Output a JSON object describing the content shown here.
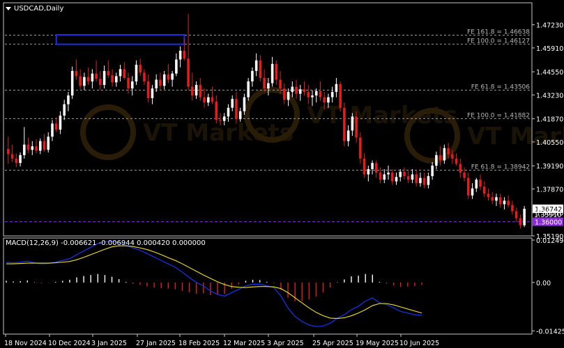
{
  "header": {
    "symbol_label": "USDCAD,Daily",
    "macd_label": "MACD(12,26,9) -0.006621 -0.006944 0.000420 0.000000"
  },
  "watermark": "VT Markets",
  "colors": {
    "background": "#000000",
    "frame": "#c8c8c8",
    "grid_dash": "#9a9a9a",
    "bull_candle": "#ffffff",
    "bear_candle": "#e01e1e",
    "price_line": "#8a2be2",
    "macd_main": "#1530e0",
    "macd_signal": "#f0e020",
    "hist_pos": "#ffffff",
    "hist_neg": "#e01e1e",
    "box": "#1c2fe6"
  },
  "chart_data": [
    {
      "type": "candlestick",
      "title": "USDCAD,Daily",
      "ylim": [
        1.3519,
        1.4785
      ],
      "y_ticks": [
        "1.47230",
        "1.45910",
        "1.44550",
        "1.43230",
        "1.41870",
        "1.40550",
        "1.39190",
        "1.37870",
        "1.36510",
        "1.35190"
      ],
      "x_ticks": [
        "18 Nov 2024",
        "10 Dec 2024",
        "3 Jan 2025",
        "27 Jan 2025",
        "18 Feb 2025",
        "12 Mar 2025",
        "3 Apr 2025",
        "25 Apr 2025",
        "19 May 2025",
        "10 Jun 2025"
      ],
      "fib_levels": [
        {
          "label": "FE 161.8 = 1.46638",
          "value": 1.46638
        },
        {
          "label": "FE 100.0 = 1.46127",
          "value": 1.46127
        },
        {
          "label": "FE 61.8 = 1.43506",
          "value": 1.43506
        },
        {
          "label": "FE 100.0 = 1.41882",
          "value": 1.41882
        },
        {
          "label": "FE 61.8 = 1.38942",
          "value": 1.38942
        }
      ],
      "current_price": "1.36742",
      "marked_level": {
        "label": "1.36000",
        "value": 1.36
      },
      "partial_label": "1.35910",
      "highlight_zone": {
        "x_from": "6 Dec 2024",
        "x_to": "31 Jan 2025",
        "y_from": 1.4612,
        "y_to": 1.4666
      },
      "candles": [
        [
          1.4015,
          1.4085,
          1.393,
          1.3985
        ],
        [
          1.3985,
          1.404,
          1.394,
          1.396
        ],
        [
          1.396,
          1.399,
          1.391,
          1.3935
        ],
        [
          1.3935,
          1.3995,
          1.3915,
          1.398
        ],
        [
          1.398,
          1.414,
          1.396,
          1.404
        ],
        [
          1.404,
          1.408,
          1.399,
          1.401
        ],
        [
          1.401,
          1.406,
          1.398,
          1.403
        ],
        [
          1.403,
          1.407,
          1.399,
          1.4005
        ],
        [
          1.4005,
          1.4075,
          1.3985,
          1.406
        ],
        [
          1.406,
          1.41,
          1.4,
          1.401
        ],
        [
          1.401,
          1.411,
          1.3995,
          1.4085
        ],
        [
          1.4085,
          1.418,
          1.406,
          1.416
        ],
        [
          1.416,
          1.4195,
          1.411,
          1.4125
        ],
        [
          1.4125,
          1.423,
          1.41,
          1.4205
        ],
        [
          1.4205,
          1.4295,
          1.418,
          1.427
        ],
        [
          1.427,
          1.434,
          1.423,
          1.432
        ],
        [
          1.432,
          1.4485,
          1.43,
          1.446
        ],
        [
          1.446,
          1.4525,
          1.441,
          1.443
        ],
        [
          1.443,
          1.447,
          1.4355,
          1.4375
        ],
        [
          1.4375,
          1.445,
          1.435,
          1.4425
        ],
        [
          1.4425,
          1.448,
          1.438,
          1.44
        ],
        [
          1.44,
          1.447,
          1.436,
          1.4445
        ],
        [
          1.4445,
          1.452,
          1.44,
          1.4415
        ],
        [
          1.4415,
          1.446,
          1.435,
          1.438
        ],
        [
          1.438,
          1.449,
          1.436,
          1.446
        ],
        [
          1.446,
          1.452,
          1.442,
          1.4435
        ],
        [
          1.4435,
          1.447,
          1.437,
          1.4395
        ],
        [
          1.4395,
          1.445,
          1.437,
          1.443
        ],
        [
          1.443,
          1.4495,
          1.44,
          1.447
        ],
        [
          1.447,
          1.451,
          1.441,
          1.442
        ],
        [
          1.442,
          1.445,
          1.433,
          1.436
        ],
        [
          1.436,
          1.443,
          1.432,
          1.44
        ],
        [
          1.44,
          1.452,
          1.438,
          1.4495
        ],
        [
          1.4495,
          1.453,
          1.443,
          1.445
        ],
        [
          1.445,
          1.447,
          1.438,
          1.44
        ],
        [
          1.44,
          1.444,
          1.428,
          1.4305
        ],
        [
          1.4305,
          1.438,
          1.427,
          1.436
        ],
        [
          1.436,
          1.444,
          1.434,
          1.441
        ],
        [
          1.441,
          1.445,
          1.435,
          1.4375
        ],
        [
          1.4375,
          1.446,
          1.4355,
          1.444
        ],
        [
          1.444,
          1.45,
          1.439,
          1.441
        ],
        [
          1.441,
          1.446,
          1.437,
          1.4445
        ],
        [
          1.4445,
          1.456,
          1.443,
          1.4525
        ],
        [
          1.4525,
          1.46,
          1.448,
          1.4575
        ],
        [
          1.4575,
          1.464,
          1.452,
          1.453
        ],
        [
          1.453,
          1.4785,
          1.435,
          1.437
        ],
        [
          1.437,
          1.445,
          1.429,
          1.432
        ],
        [
          1.432,
          1.44,
          1.43,
          1.438
        ],
        [
          1.438,
          1.442,
          1.429,
          1.431
        ],
        [
          1.431,
          1.436,
          1.425,
          1.428
        ],
        [
          1.428,
          1.433,
          1.426,
          1.431
        ],
        [
          1.431,
          1.437,
          1.427,
          1.4285
        ],
        [
          1.4285,
          1.432,
          1.416,
          1.418
        ],
        [
          1.418,
          1.422,
          1.415,
          1.4175
        ],
        [
          1.4175,
          1.422,
          1.415,
          1.42
        ],
        [
          1.42,
          1.427,
          1.417,
          1.425
        ],
        [
          1.425,
          1.432,
          1.423,
          1.43
        ],
        [
          1.43,
          1.434,
          1.416,
          1.4185
        ],
        [
          1.4185,
          1.425,
          1.417,
          1.423
        ],
        [
          1.423,
          1.433,
          1.421,
          1.431
        ],
        [
          1.431,
          1.442,
          1.429,
          1.44
        ],
        [
          1.44,
          1.448,
          1.437,
          1.446
        ],
        [
          1.446,
          1.456,
          1.443,
          1.452
        ],
        [
          1.452,
          1.455,
          1.44,
          1.442
        ],
        [
          1.442,
          1.447,
          1.434,
          1.436
        ],
        [
          1.436,
          1.442,
          1.432,
          1.439
        ],
        [
          1.439,
          1.454,
          1.437,
          1.45
        ],
        [
          1.45,
          1.452,
          1.438,
          1.441
        ],
        [
          1.441,
          1.446,
          1.433,
          1.436
        ],
        [
          1.436,
          1.439,
          1.427,
          1.4295
        ],
        [
          1.4295,
          1.436,
          1.426,
          1.434
        ],
        [
          1.434,
          1.44,
          1.431,
          1.437
        ],
        [
          1.437,
          1.441,
          1.43,
          1.433
        ],
        [
          1.433,
          1.438,
          1.429,
          1.4355
        ],
        [
          1.4355,
          1.44,
          1.432,
          1.434
        ],
        [
          1.434,
          1.438,
          1.427,
          1.431
        ],
        [
          1.431,
          1.435,
          1.426,
          1.432
        ],
        [
          1.432,
          1.436,
          1.428,
          1.4345
        ],
        [
          1.4345,
          1.44,
          1.429,
          1.431
        ],
        [
          1.431,
          1.434,
          1.424,
          1.428
        ],
        [
          1.428,
          1.433,
          1.425,
          1.431
        ],
        [
          1.431,
          1.437,
          1.428,
          1.434
        ],
        [
          1.434,
          1.442,
          1.431,
          1.4385
        ],
        [
          1.4385,
          1.44,
          1.423,
          1.425
        ],
        [
          1.425,
          1.428,
          1.403,
          1.406
        ],
        [
          1.406,
          1.415,
          1.403,
          1.412
        ],
        [
          1.412,
          1.422,
          1.409,
          1.42
        ],
        [
          1.42,
          1.423,
          1.405,
          1.408
        ],
        [
          1.408,
          1.411,
          1.393,
          1.396
        ],
        [
          1.396,
          1.399,
          1.385,
          1.387
        ],
        [
          1.387,
          1.392,
          1.383,
          1.39
        ],
        [
          1.39,
          1.395,
          1.387,
          1.3935
        ],
        [
          1.3935,
          1.395,
          1.385,
          1.388
        ],
        [
          1.388,
          1.391,
          1.382,
          1.384
        ],
        [
          1.384,
          1.39,
          1.382,
          1.387
        ],
        [
          1.387,
          1.392,
          1.384,
          1.388
        ],
        [
          1.388,
          1.39,
          1.381,
          1.383
        ],
        [
          1.383,
          1.388,
          1.381,
          1.3855
        ],
        [
          1.3855,
          1.39,
          1.383,
          1.3885
        ],
        [
          1.3885,
          1.391,
          1.384,
          1.386
        ],
        [
          1.386,
          1.389,
          1.382,
          1.384
        ],
        [
          1.384,
          1.39,
          1.382,
          1.387
        ],
        [
          1.387,
          1.3895,
          1.38,
          1.382
        ],
        [
          1.382,
          1.388,
          1.38,
          1.385
        ],
        [
          1.385,
          1.388,
          1.379,
          1.381
        ],
        [
          1.381,
          1.388,
          1.379,
          1.386
        ],
        [
          1.386,
          1.394,
          1.384,
          1.392
        ],
        [
          1.392,
          1.4,
          1.39,
          1.398
        ],
        [
          1.398,
          1.403,
          1.392,
          1.395
        ],
        [
          1.395,
          1.404,
          1.393,
          1.402
        ],
        [
          1.402,
          1.405,
          1.396,
          1.3985
        ],
        [
          1.3985,
          1.401,
          1.393,
          1.396
        ],
        [
          1.396,
          1.399,
          1.392,
          1.393
        ],
        [
          1.393,
          1.396,
          1.385,
          1.388
        ],
        [
          1.388,
          1.391,
          1.383,
          1.385
        ],
        [
          1.385,
          1.388,
          1.373,
          1.375
        ],
        [
          1.375,
          1.382,
          1.373,
          1.379
        ],
        [
          1.379,
          1.385,
          1.377,
          1.384
        ],
        [
          1.384,
          1.387,
          1.378,
          1.38
        ],
        [
          1.38,
          1.383,
          1.374,
          1.376
        ],
        [
          1.376,
          1.379,
          1.372,
          1.374
        ],
        [
          1.374,
          1.377,
          1.37,
          1.372
        ],
        [
          1.372,
          1.376,
          1.369,
          1.374
        ],
        [
          1.374,
          1.376,
          1.368,
          1.37
        ],
        [
          1.37,
          1.374,
          1.367,
          1.372
        ],
        [
          1.372,
          1.375,
          1.368,
          1.3695
        ],
        [
          1.3695,
          1.372,
          1.364,
          1.366
        ],
        [
          1.366,
          1.368,
          1.36,
          1.362
        ],
        [
          1.362,
          1.364,
          1.356,
          1.358
        ],
        [
          1.358,
          1.369,
          1.357,
          1.3674
        ]
      ]
    },
    {
      "type": "line",
      "title": "MACD(12,26,9) -0.006621 -0.006944 0.000420 0.000000",
      "ylim": [
        -0.0152,
        0.0131
      ],
      "y_ticks": [
        "0.012494",
        "0.00",
        "-0.014259"
      ],
      "series": [
        {
          "name": "MACD",
          "values": [
            0.006,
            0.0058,
            0.006,
            0.0063,
            0.0058,
            0.0055,
            0.0056,
            0.006,
            0.0065,
            0.007,
            0.0082,
            0.0093,
            0.0104,
            0.0115,
            0.012,
            0.0122,
            0.0118,
            0.011,
            0.0102,
            0.0095,
            0.0085,
            0.0075,
            0.0065,
            0.0055,
            0.0045,
            0.003,
            0.0015,
            0.0,
            -0.001,
            -0.0025,
            -0.0035,
            -0.004,
            -0.003,
            -0.002,
            -0.001,
            -0.0005,
            -0.0005,
            -0.001,
            -0.0015,
            -0.004,
            -0.0075,
            -0.01,
            -0.0115,
            -0.0125,
            -0.013,
            -0.0128,
            -0.012,
            -0.0105,
            -0.0095,
            -0.008,
            -0.007,
            -0.0055,
            -0.0045,
            -0.006,
            -0.0065,
            -0.0075,
            -0.0085,
            -0.009,
            -0.0095,
            -0.0097
          ]
        },
        {
          "name": "Signal",
          "values": [
            0.0055,
            0.0055,
            0.0056,
            0.0057,
            0.0057,
            0.0057,
            0.0057,
            0.0058,
            0.006,
            0.0062,
            0.0067,
            0.0074,
            0.0082,
            0.009,
            0.0098,
            0.0105,
            0.0108,
            0.0108,
            0.0106,
            0.0102,
            0.0097,
            0.009,
            0.0082,
            0.0073,
            0.0065,
            0.0055,
            0.0044,
            0.0033,
            0.0022,
            0.0012,
            0.0002,
            -0.0006,
            -0.0012,
            -0.0014,
            -0.0015,
            -0.0013,
            -0.0012,
            -0.0012,
            -0.0013,
            -0.0018,
            -0.003,
            -0.0045,
            -0.006,
            -0.0075,
            -0.0088,
            -0.0098,
            -0.0105,
            -0.0106,
            -0.0104,
            -0.0098,
            -0.009,
            -0.008,
            -0.0068,
            -0.0062,
            -0.0062,
            -0.0066,
            -0.0072,
            -0.0078,
            -0.0084,
            -0.009
          ]
        },
        {
          "name": "Histogram",
          "values": [
            0.0005,
            0.0003,
            0.0004,
            0.0006,
            0.0001,
            -0.0002,
            -0.0001,
            0.0002,
            0.0005,
            0.0008,
            0.0015,
            0.0019,
            0.0022,
            0.0025,
            0.0022,
            0.0017,
            0.001,
            0.0002,
            -0.0004,
            -0.0007,
            -0.0012,
            -0.0015,
            -0.0017,
            -0.0018,
            -0.002,
            -0.0025,
            -0.0029,
            -0.0033,
            -0.0032,
            -0.0037,
            -0.0037,
            -0.0034,
            -0.0018,
            -0.0006,
            0.0005,
            0.0008,
            0.0007,
            0.0002,
            -0.0002,
            -0.0022,
            -0.0045,
            -0.0055,
            -0.0055,
            -0.005,
            -0.0042,
            -0.003,
            -0.0015,
            0.0001,
            0.0009,
            0.0018,
            0.002,
            0.0025,
            0.0023,
            0.0002,
            -0.0003,
            -0.0009,
            -0.0013,
            -0.0012,
            -0.0011,
            -0.0007
          ]
        }
      ]
    }
  ]
}
